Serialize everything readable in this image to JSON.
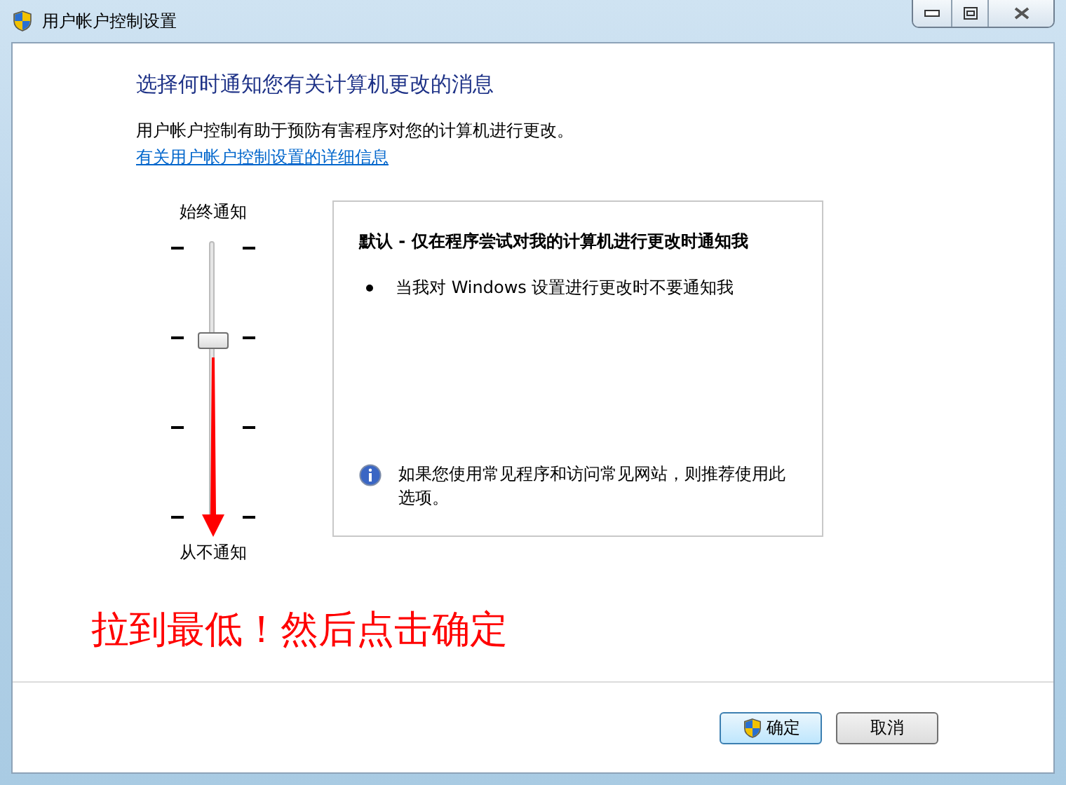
{
  "window": {
    "title": "用户帐户控制设置"
  },
  "heading": "选择何时通知您有关计算机更改的消息",
  "description": "用户帐户控制有助于预防有害程序对您的计算机进行更改。",
  "link": "有关用户帐户控制设置的详细信息",
  "slider": {
    "top_label": "始终通知",
    "bottom_label": "从不通知",
    "level": 0.667
  },
  "info_panel": {
    "title": "默认 - 仅在程序尝试对我的计算机进行更改时通知我",
    "bullets": [
      "当我对 Windows 设置进行更改时不要通知我"
    ],
    "note": "如果您使用常见程序和访问常见网站，则推荐使用此选项。"
  },
  "annotation": {
    "text": "拉到最低！然后点击确定"
  },
  "buttons": [
    {
      "label": "确定",
      "kind": "primary"
    },
    {
      "label": "取消",
      "kind": "normal"
    }
  ]
}
